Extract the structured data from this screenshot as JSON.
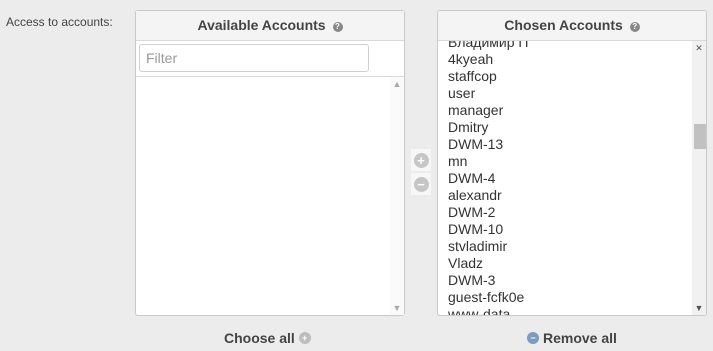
{
  "form": {
    "label": "Access to accounts:"
  },
  "available": {
    "title": "Available Accounts",
    "help_icon": "help-icon",
    "filter_placeholder": "Filter",
    "choose_all_label": "Choose all"
  },
  "chosen": {
    "title": "Chosen Accounts",
    "help_icon": "help-icon",
    "remove_all_label": "Remove all",
    "items": [
      "Владимир П",
      "4kyeah",
      "staffcop",
      "user",
      "manager",
      "Dmitry",
      "DWM-13",
      "mn",
      "DWM-4",
      "alexandr",
      "DWM-2",
      "DWM-10",
      "stvladimir",
      "Vladz",
      "DWM-3",
      "guest-fcfk0e",
      "www-data"
    ]
  },
  "controls": {
    "add_icon": "plus-circle-icon",
    "remove_icon": "minus-circle-icon"
  }
}
